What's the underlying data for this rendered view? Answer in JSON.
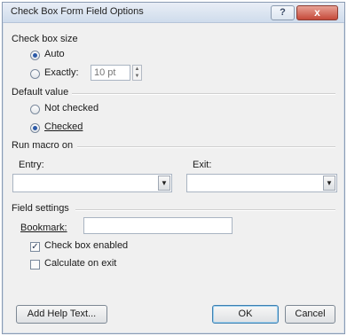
{
  "window": {
    "title": "Check Box Form Field Options",
    "help_button": "?",
    "close_button": "x"
  },
  "check_box_size": {
    "title": "Check box size",
    "auto_label": "Auto",
    "exactly_label": "Exactly:",
    "exactly_value": "10 pt",
    "selected": "auto"
  },
  "default_value": {
    "title": "Default value",
    "not_checked_label": "Not checked",
    "checked_label": "Checked",
    "selected": "checked"
  },
  "run_macro": {
    "title": "Run macro on",
    "entry_label": "Entry:",
    "entry_value": "",
    "exit_label": "Exit:",
    "exit_value": ""
  },
  "field_settings": {
    "title": "Field settings",
    "bookmark_label": "Bookmark:",
    "bookmark_value": "",
    "check_box_enabled_label": "Check box enabled",
    "check_box_enabled": true,
    "calculate_on_exit_label": "Calculate on exit",
    "calculate_on_exit": false
  },
  "buttons": {
    "add_help_text": "Add Help Text...",
    "ok": "OK",
    "cancel": "Cancel"
  }
}
